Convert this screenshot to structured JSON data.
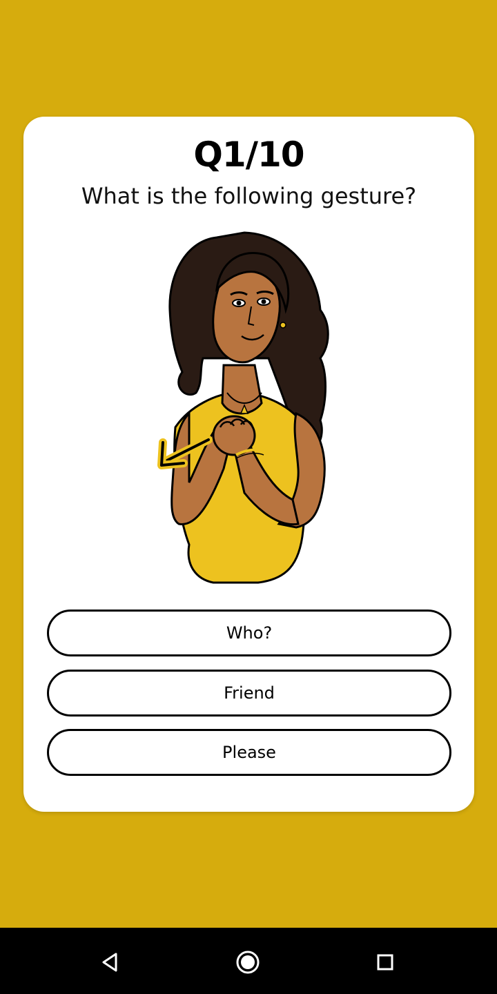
{
  "quiz": {
    "question_number": "Q1/10",
    "question_text": "What is the following gesture?",
    "illustration_icon": "sign-language-woman-illustration",
    "answers": [
      {
        "label": "Who?"
      },
      {
        "label": "Friend"
      },
      {
        "label": "Please"
      }
    ]
  },
  "navigation": {
    "icons": [
      "back-icon",
      "home-icon",
      "recent-apps-icon"
    ]
  },
  "colors": {
    "background": "#D6AC0D",
    "card": "#FFFFFF",
    "accent_yellow": "#EDC21F",
    "skin": "#B8743F",
    "hair": "#2A1B14"
  }
}
